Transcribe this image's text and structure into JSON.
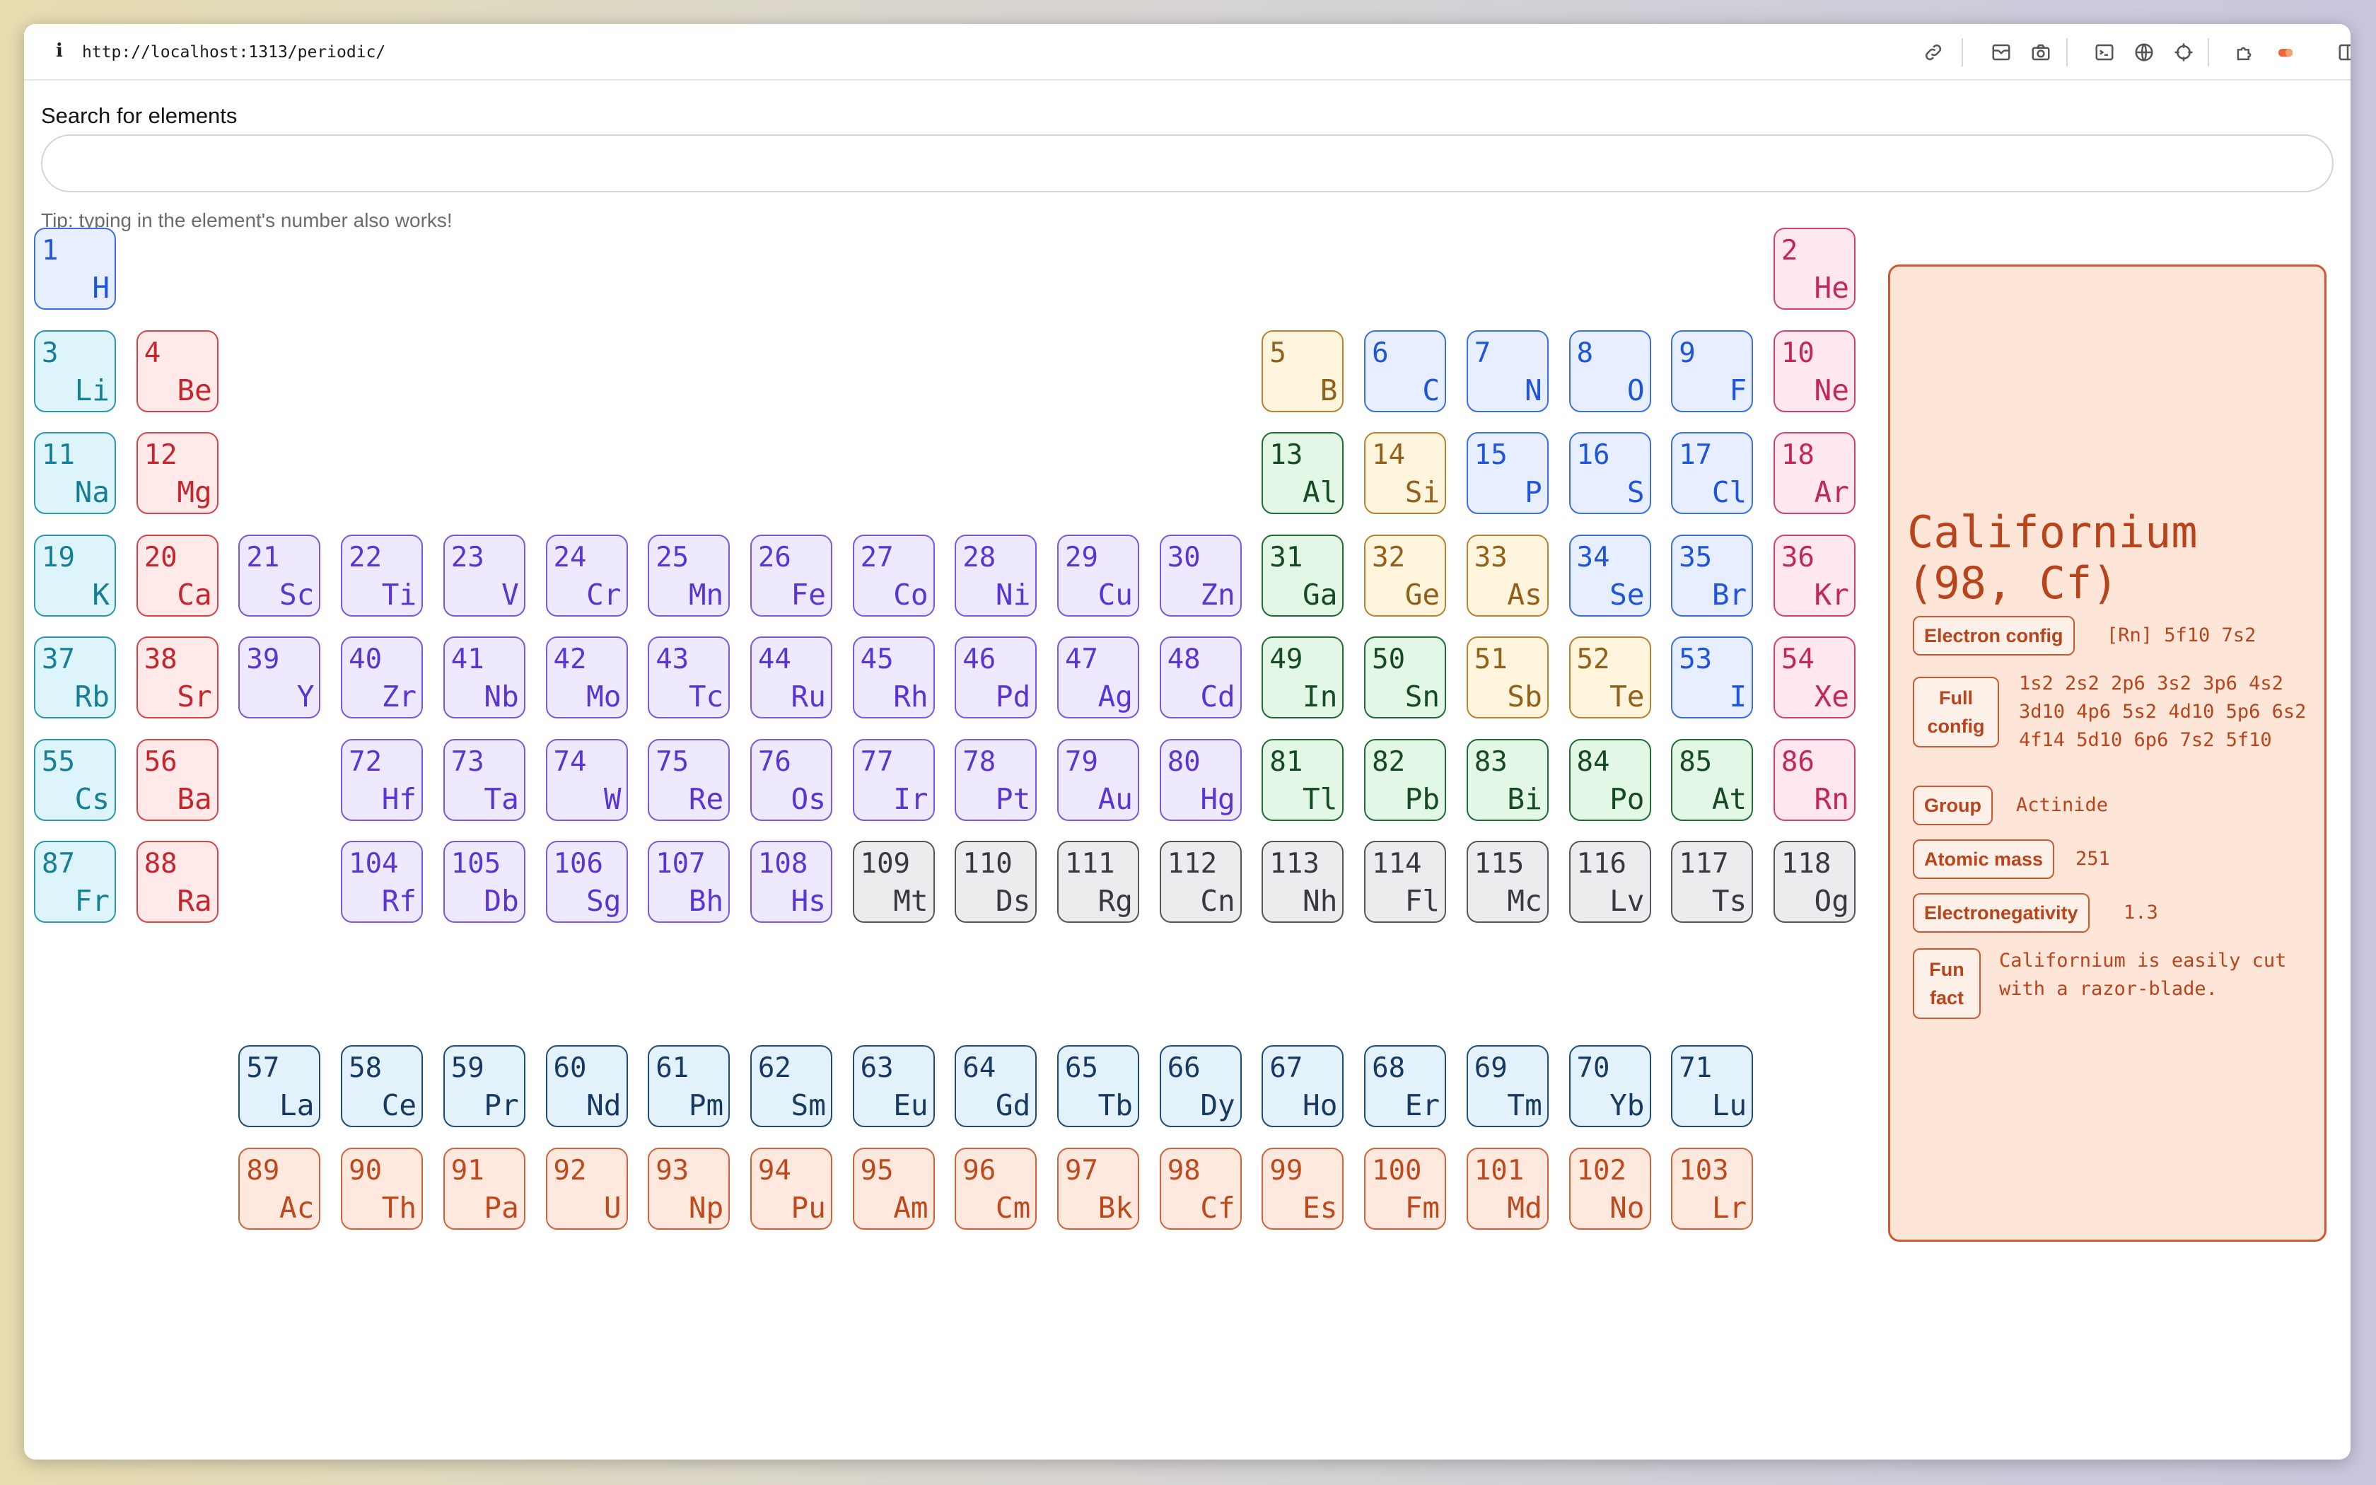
{
  "browser": {
    "url": "http://localhost:1313/periodic/",
    "info_glyph": "i"
  },
  "search": {
    "label": "Search for elements",
    "value": "",
    "placeholder": "",
    "tip": "Tip: typing in the element's number also works!"
  },
  "elements": [
    {
      "n": "1",
      "s": "H",
      "cat": "h"
    },
    {
      "n": "2",
      "s": "He",
      "cat": "ng"
    },
    {
      "n": "3",
      "s": "Li",
      "cat": "al"
    },
    {
      "n": "4",
      "s": "Be",
      "cat": "ae"
    },
    {
      "n": "5",
      "s": "B",
      "cat": "ml"
    },
    {
      "n": "6",
      "s": "C",
      "cat": "nm"
    },
    {
      "n": "7",
      "s": "N",
      "cat": "nm"
    },
    {
      "n": "8",
      "s": "O",
      "cat": "nm"
    },
    {
      "n": "9",
      "s": "F",
      "cat": "nm"
    },
    {
      "n": "10",
      "s": "Ne",
      "cat": "ng"
    },
    {
      "n": "11",
      "s": "Na",
      "cat": "al"
    },
    {
      "n": "12",
      "s": "Mg",
      "cat": "ae"
    },
    {
      "n": "13",
      "s": "Al",
      "cat": "pt"
    },
    {
      "n": "14",
      "s": "Si",
      "cat": "ml"
    },
    {
      "n": "15",
      "s": "P",
      "cat": "nm"
    },
    {
      "n": "16",
      "s": "S",
      "cat": "nm"
    },
    {
      "n": "17",
      "s": "Cl",
      "cat": "nm"
    },
    {
      "n": "18",
      "s": "Ar",
      "cat": "ng"
    },
    {
      "n": "19",
      "s": "K",
      "cat": "al"
    },
    {
      "n": "20",
      "s": "Ca",
      "cat": "ae"
    },
    {
      "n": "21",
      "s": "Sc",
      "cat": "tm"
    },
    {
      "n": "22",
      "s": "Ti",
      "cat": "tm"
    },
    {
      "n": "23",
      "s": "V",
      "cat": "tm"
    },
    {
      "n": "24",
      "s": "Cr",
      "cat": "tm"
    },
    {
      "n": "25",
      "s": "Mn",
      "cat": "tm"
    },
    {
      "n": "26",
      "s": "Fe",
      "cat": "tm"
    },
    {
      "n": "27",
      "s": "Co",
      "cat": "tm"
    },
    {
      "n": "28",
      "s": "Ni",
      "cat": "tm"
    },
    {
      "n": "29",
      "s": "Cu",
      "cat": "tm"
    },
    {
      "n": "30",
      "s": "Zn",
      "cat": "tm"
    },
    {
      "n": "31",
      "s": "Ga",
      "cat": "pt"
    },
    {
      "n": "32",
      "s": "Ge",
      "cat": "ml"
    },
    {
      "n": "33",
      "s": "As",
      "cat": "ml"
    },
    {
      "n": "34",
      "s": "Se",
      "cat": "nm"
    },
    {
      "n": "35",
      "s": "Br",
      "cat": "nm"
    },
    {
      "n": "36",
      "s": "Kr",
      "cat": "ng"
    },
    {
      "n": "37",
      "s": "Rb",
      "cat": "al"
    },
    {
      "n": "38",
      "s": "Sr",
      "cat": "ae"
    },
    {
      "n": "39",
      "s": "Y",
      "cat": "tm"
    },
    {
      "n": "40",
      "s": "Zr",
      "cat": "tm"
    },
    {
      "n": "41",
      "s": "Nb",
      "cat": "tm"
    },
    {
      "n": "42",
      "s": "Mo",
      "cat": "tm"
    },
    {
      "n": "43",
      "s": "Tc",
      "cat": "tm"
    },
    {
      "n": "44",
      "s": "Ru",
      "cat": "tm"
    },
    {
      "n": "45",
      "s": "Rh",
      "cat": "tm"
    },
    {
      "n": "46",
      "s": "Pd",
      "cat": "tm"
    },
    {
      "n": "47",
      "s": "Ag",
      "cat": "tm"
    },
    {
      "n": "48",
      "s": "Cd",
      "cat": "tm"
    },
    {
      "n": "49",
      "s": "In",
      "cat": "pt"
    },
    {
      "n": "50",
      "s": "Sn",
      "cat": "pt"
    },
    {
      "n": "51",
      "s": "Sb",
      "cat": "ml"
    },
    {
      "n": "52",
      "s": "Te",
      "cat": "ml"
    },
    {
      "n": "53",
      "s": "I",
      "cat": "nm"
    },
    {
      "n": "54",
      "s": "Xe",
      "cat": "ng"
    },
    {
      "n": "55",
      "s": "Cs",
      "cat": "al"
    },
    {
      "n": "56",
      "s": "Ba",
      "cat": "ae"
    },
    {
      "n": "72",
      "s": "Hf",
      "cat": "tm"
    },
    {
      "n": "73",
      "s": "Ta",
      "cat": "tm"
    },
    {
      "n": "74",
      "s": "W",
      "cat": "tm"
    },
    {
      "n": "75",
      "s": "Re",
      "cat": "tm"
    },
    {
      "n": "76",
      "s": "Os",
      "cat": "tm"
    },
    {
      "n": "77",
      "s": "Ir",
      "cat": "tm"
    },
    {
      "n": "78",
      "s": "Pt",
      "cat": "tm"
    },
    {
      "n": "79",
      "s": "Au",
      "cat": "tm"
    },
    {
      "n": "80",
      "s": "Hg",
      "cat": "tm"
    },
    {
      "n": "81",
      "s": "Tl",
      "cat": "pt"
    },
    {
      "n": "82",
      "s": "Pb",
      "cat": "pt"
    },
    {
      "n": "83",
      "s": "Bi",
      "cat": "pt"
    },
    {
      "n": "84",
      "s": "Po",
      "cat": "pt"
    },
    {
      "n": "85",
      "s": "At",
      "cat": "pt"
    },
    {
      "n": "86",
      "s": "Rn",
      "cat": "ng"
    },
    {
      "n": "87",
      "s": "Fr",
      "cat": "al"
    },
    {
      "n": "88",
      "s": "Ra",
      "cat": "ae"
    },
    {
      "n": "104",
      "s": "Rf",
      "cat": "tm"
    },
    {
      "n": "105",
      "s": "Db",
      "cat": "tm"
    },
    {
      "n": "106",
      "s": "Sg",
      "cat": "tm"
    },
    {
      "n": "107",
      "s": "Bh",
      "cat": "tm"
    },
    {
      "n": "108",
      "s": "Hs",
      "cat": "tm"
    },
    {
      "n": "109",
      "s": "Mt",
      "cat": "un"
    },
    {
      "n": "110",
      "s": "Ds",
      "cat": "un"
    },
    {
      "n": "111",
      "s": "Rg",
      "cat": "un"
    },
    {
      "n": "112",
      "s": "Cn",
      "cat": "un"
    },
    {
      "n": "113",
      "s": "Nh",
      "cat": "un"
    },
    {
      "n": "114",
      "s": "Fl",
      "cat": "un"
    },
    {
      "n": "115",
      "s": "Mc",
      "cat": "un"
    },
    {
      "n": "116",
      "s": "Lv",
      "cat": "un"
    },
    {
      "n": "117",
      "s": "Ts",
      "cat": "un"
    },
    {
      "n": "118",
      "s": "Og",
      "cat": "un"
    },
    {
      "n": "57",
      "s": "La",
      "cat": "la"
    },
    {
      "n": "58",
      "s": "Ce",
      "cat": "la"
    },
    {
      "n": "59",
      "s": "Pr",
      "cat": "la"
    },
    {
      "n": "60",
      "s": "Nd",
      "cat": "la"
    },
    {
      "n": "61",
      "s": "Pm",
      "cat": "la"
    },
    {
      "n": "62",
      "s": "Sm",
      "cat": "la"
    },
    {
      "n": "63",
      "s": "Eu",
      "cat": "la"
    },
    {
      "n": "64",
      "s": "Gd",
      "cat": "la"
    },
    {
      "n": "65",
      "s": "Tb",
      "cat": "la"
    },
    {
      "n": "66",
      "s": "Dy",
      "cat": "la"
    },
    {
      "n": "67",
      "s": "Ho",
      "cat": "la"
    },
    {
      "n": "68",
      "s": "Er",
      "cat": "la"
    },
    {
      "n": "69",
      "s": "Tm",
      "cat": "la"
    },
    {
      "n": "70",
      "s": "Yb",
      "cat": "la"
    },
    {
      "n": "71",
      "s": "Lu",
      "cat": "la"
    },
    {
      "n": "89",
      "s": "Ac",
      "cat": "ac"
    },
    {
      "n": "90",
      "s": "Th",
      "cat": "ac"
    },
    {
      "n": "91",
      "s": "Pa",
      "cat": "ac"
    },
    {
      "n": "92",
      "s": "U",
      "cat": "ac"
    },
    {
      "n": "93",
      "s": "Np",
      "cat": "ac"
    },
    {
      "n": "94",
      "s": "Pu",
      "cat": "ac"
    },
    {
      "n": "95",
      "s": "Am",
      "cat": "ac"
    },
    {
      "n": "96",
      "s": "Cm",
      "cat": "ac"
    },
    {
      "n": "97",
      "s": "Bk",
      "cat": "ac"
    },
    {
      "n": "98",
      "s": "Cf",
      "cat": "ac"
    },
    {
      "n": "99",
      "s": "Es",
      "cat": "ac"
    },
    {
      "n": "100",
      "s": "Fm",
      "cat": "ac"
    },
    {
      "n": "101",
      "s": "Md",
      "cat": "ac"
    },
    {
      "n": "102",
      "s": "No",
      "cat": "ac"
    },
    {
      "n": "103",
      "s": "Lr",
      "cat": "ac"
    }
  ],
  "detail": {
    "title": "Californium (98, Cf)",
    "electron_config_label": "Electron config",
    "electron_config": "[Rn] 5f10 7s2",
    "full_config_label": "Full config",
    "full_config": "1s2 2s2 2p6 3s2 3p6 4s2 3d10 4p6 5s2 4d10 5p6 6s2 4f14 5d10 6p6 7s2 5f10",
    "group_label": "Group",
    "group": "Actinide",
    "atomic_mass_label": "Atomic mass",
    "atomic_mass": "251",
    "electronegativity_label": "Electronegativity",
    "electronegativity": "1.3",
    "fun_fact_label": "Fun fact",
    "fun_fact": "Californium is easily cut with a razor-blade."
  },
  "toolbar_icons": [
    "link-icon",
    "save-to-pocket-icon",
    "camera-icon",
    "terminal-icon",
    "globe-icon",
    "crosshair-icon",
    "extensions-icon",
    "eraser-icon",
    "sidebar-icon"
  ],
  "colors": {
    "detail_accent": "#cf5a32",
    "detail_background": "#fde6d8"
  }
}
